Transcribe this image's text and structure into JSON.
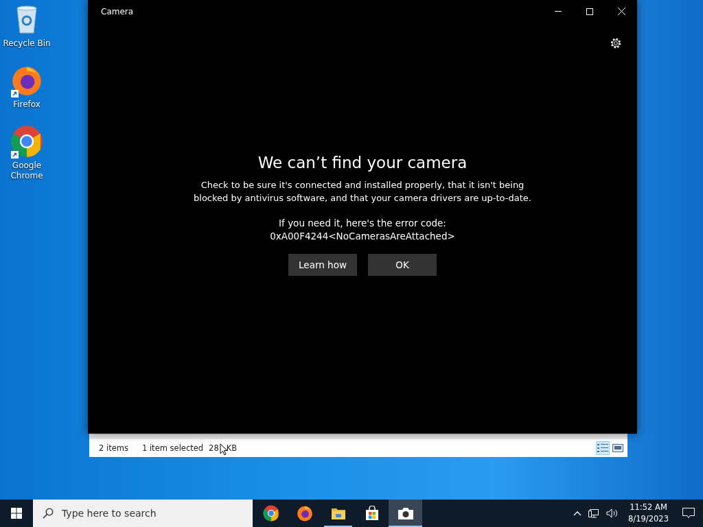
{
  "desktop_icons": [
    {
      "kind": "recycle",
      "label": "Recycle Bin",
      "shortcut": false
    },
    {
      "kind": "firefox",
      "label": "Firefox",
      "shortcut": true
    },
    {
      "kind": "chrome",
      "label": "Google Chrome",
      "shortcut": true
    }
  ],
  "camera_window": {
    "title": "Camera",
    "heading": "We can’t find your camera",
    "message": "Check to be sure it's connected and installed properly, that it isn't being blocked by antivirus software, and that your camera drivers are up-to-date.",
    "error_intro": "If you need it, here's the error code:",
    "error_code": "0xA00F4244<NoCamerasAreAttached>",
    "buttons": [
      "Learn how",
      "OK"
    ]
  },
  "explorer_status": {
    "items": "2 items",
    "selection": "1 item selected",
    "size_start": "28",
    "size_end": "KB",
    "views": [
      {
        "kind": "details",
        "selected": true
      },
      {
        "kind": "large",
        "selected": false
      }
    ]
  },
  "taskbar": {
    "search": {
      "placeholder": "Type here to search"
    },
    "apps": [
      {
        "kind": "chrome",
        "running": false,
        "selected": false
      },
      {
        "kind": "firefox",
        "running": false,
        "selected": false
      },
      {
        "kind": "explorer",
        "running": true,
        "selected": false
      },
      {
        "kind": "store",
        "running": false,
        "selected": false
      },
      {
        "kind": "camera",
        "running": true,
        "selected": true
      }
    ],
    "time": "11:52 AM",
    "date": "8/19/2023"
  }
}
